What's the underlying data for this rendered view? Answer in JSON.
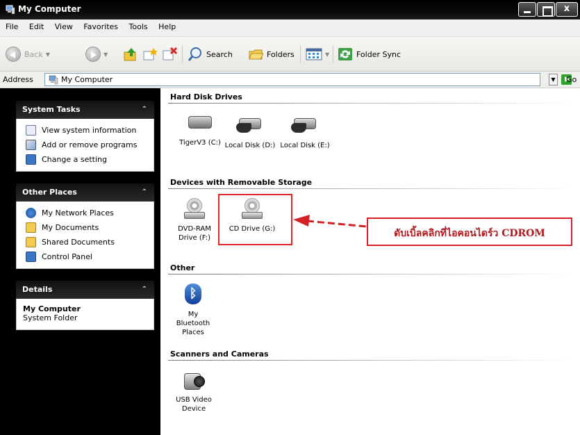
{
  "window": {
    "title": "My Computer",
    "close_label": "x"
  },
  "menu": [
    "File",
    "Edit",
    "View",
    "Favorites",
    "Tools",
    "Help"
  ],
  "toolbar": {
    "back_label": "Back",
    "search_label": "Search",
    "folders_label": "Folders",
    "folder_sync_label": "Folder Sync"
  },
  "address": {
    "label": "Address",
    "value": "My Computer",
    "go_label": "Go"
  },
  "left_pane": {
    "system_tasks": {
      "title": "System Tasks",
      "items": [
        {
          "label": "View system information",
          "icon": "system-info-icon"
        },
        {
          "label": "Add or remove programs",
          "icon": "add-remove-programs-icon"
        },
        {
          "label": "Change a setting",
          "icon": "control-panel-icon"
        }
      ]
    },
    "other_places": {
      "title": "Other Places",
      "items": [
        {
          "label": "My Network Places",
          "icon": "network-places-icon"
        },
        {
          "label": "My Documents",
          "icon": "documents-folder-icon"
        },
        {
          "label": "Shared Documents",
          "icon": "shared-folder-icon"
        },
        {
          "label": "Control Panel",
          "icon": "control-panel-icon"
        }
      ]
    },
    "details": {
      "title": "Details",
      "name": "My Computer",
      "type": "System Folder"
    }
  },
  "content": {
    "groups": [
      {
        "title": "Hard Disk Drives",
        "items": [
          {
            "label": "TigerV3 (C:)",
            "icon": "hard-disk-icon"
          },
          {
            "label": "Local Disk (D:)",
            "icon": "shared-hard-disk-icon"
          },
          {
            "label": "Local Disk (E:)",
            "icon": "shared-hard-disk-icon"
          }
        ]
      },
      {
        "title": "Devices with Removable Storage",
        "items": [
          {
            "label_line1": "DVD-RAM",
            "label_line2": "Drive (F:)",
            "icon": "dvd-drive-icon"
          },
          {
            "label": "CD Drive (G:)",
            "icon": "cd-drive-icon"
          }
        ]
      },
      {
        "title": "Other",
        "items": [
          {
            "label_line1": "My Bluetooth",
            "label_line2": "Places",
            "icon": "bluetooth-icon"
          }
        ]
      },
      {
        "title": "Scanners and Cameras",
        "items": [
          {
            "label_line1": "USB Video",
            "label_line2": "Device",
            "icon": "webcam-icon"
          }
        ]
      }
    ],
    "annotation": "ดับเบิ้ลคลิกที่ไอคอนไดร์ว CDROM",
    "annotation_color": "#b3171c"
  }
}
